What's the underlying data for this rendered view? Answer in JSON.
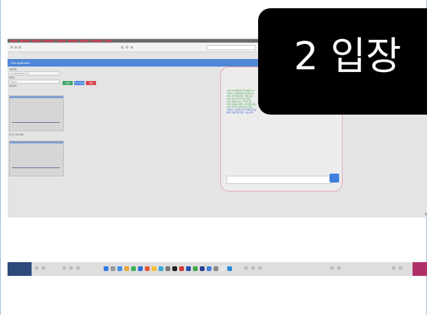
{
  "overlay": {
    "title": "2 입장"
  },
  "colors": {
    "banner": "#4f86d6",
    "btn_green": "#3fa66a",
    "btn_blue": "#3f7fe0",
    "btn_red": "#d9464f",
    "chat_border": "#e7a6b0",
    "send": "#3f7fe0"
  },
  "screen": {
    "app_title": "Chat Application",
    "form": {
      "label_1": "사용자명",
      "field_1": "user@example.com",
      "label_2": "방번호",
      "field_2": "Room 1",
      "label_3": "접속상태",
      "buttons": [
        "입장",
        "메시지전송",
        "퇴장"
      ]
    },
    "section_label": "실시간 영상 채팅",
    "chat_lines": [
      {
        "text": "서버: 2명 채팅방에 입장했습니다",
        "color": "#3aa040"
      },
      {
        "text": "사용자1: 안녕하세요 반갑습니다",
        "color": "#3aa040"
      },
      {
        "text": "서버: 2명 입장완료 - 연결 성공",
        "color": "#3aa040"
      },
      {
        "text": "서버: 메시지 수신 준비 완료",
        "color": "#3aa040"
      },
      {
        "text": "서버: 채팅 서비스 시작합니다",
        "color": "#3aa040"
      },
      {
        "text": "서버: 사용자2 입장 - 인사해주세요",
        "color": "#3aa040"
      },
      {
        "text": "서버: 메시지 전송 테스트 완료",
        "color": "#3aa040"
      },
      {
        "text": "사용자2: 반갑습니다 잘 부탁드려요",
        "color": "#3a5cd0"
      },
      {
        "text": "채팅 기록 저장 완료 - 세션 유지",
        "color": "#3a5cd0"
      }
    ],
    "chat_input_placeholder": ""
  }
}
